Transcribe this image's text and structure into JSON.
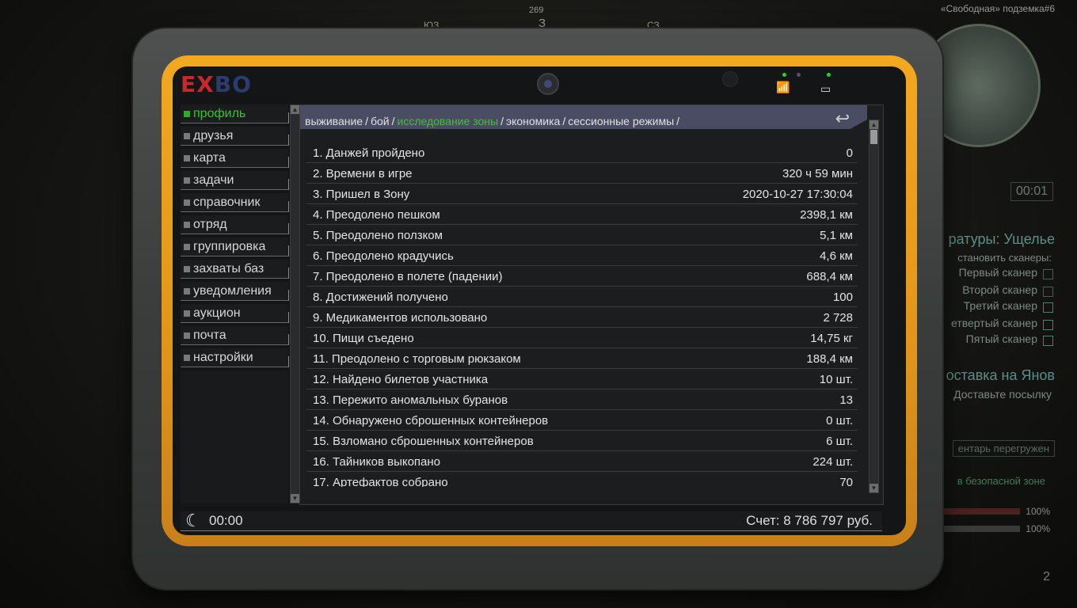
{
  "hud": {
    "compass": {
      "heading": "269",
      "w": "З",
      "sw": "ЮЗ",
      "nw": "СЗ"
    },
    "location": "«Свободная» подземка#6",
    "timer": "00:01",
    "quest": {
      "title": "ратуры: Ущелье",
      "subtitle": "становить сканеры:",
      "items": [
        "Первый сканер",
        "Второй сканер",
        "Третий сканер",
        "етвертый сканер",
        "Пятый сканер"
      ]
    },
    "quest2": {
      "title": "оставка на Янов",
      "subtitle": "Доставьте посылку"
    },
    "warning": "ентарь перегружен",
    "safe_zone": "в безопасной зоне",
    "health_pct": "100%",
    "stamina_pct": "100%",
    "counter": "2"
  },
  "pda": {
    "brand_e": "E",
    "brand_x": "X",
    "brand_bo": "BO",
    "sidebar": [
      {
        "label": "профиль",
        "active": true
      },
      {
        "label": "друзья"
      },
      {
        "label": "карта"
      },
      {
        "label": "задачи"
      },
      {
        "label": "справочник"
      },
      {
        "label": "отряд"
      },
      {
        "label": "группировка"
      },
      {
        "label": "захваты баз"
      },
      {
        "label": "уведомления"
      },
      {
        "label": "аукцион"
      },
      {
        "label": "почта"
      },
      {
        "label": "настройки"
      }
    ],
    "breadcrumbs": [
      {
        "label": "выживание"
      },
      {
        "label": "бой"
      },
      {
        "label": "исследование зоны",
        "active": true
      },
      {
        "label": "экономика"
      },
      {
        "label": "сессионные режимы"
      }
    ],
    "stats": [
      {
        "label": "1. Данжей пройдено",
        "value": "0"
      },
      {
        "label": "2. Времени в игре",
        "value": "320 ч 59 мин"
      },
      {
        "label": "3. Пришел в Зону",
        "value": "2020-10-27 17:30:04"
      },
      {
        "label": "4. Преодолено пешком",
        "value": "2398,1 км"
      },
      {
        "label": "5. Преодолено ползком",
        "value": "5,1 км"
      },
      {
        "label": "6. Преодолено крадучись",
        "value": "4,6 км"
      },
      {
        "label": "7. Преодолено в полете (падении)",
        "value": "688,4 км"
      },
      {
        "label": "8. Достижений получено",
        "value": "100"
      },
      {
        "label": "9. Медикаментов использовано",
        "value": "2 728"
      },
      {
        "label": "10. Пищи съедено",
        "value": "14,75 кг"
      },
      {
        "label": "11. Преодолено с торговым рюкзаком",
        "value": "188,4 км"
      },
      {
        "label": "12. Найдено билетов участника",
        "value": "10 шт."
      },
      {
        "label": "13. Пережито аномальных буранов",
        "value": "13"
      },
      {
        "label": "14. Обнаружено сброшенных контейнеров",
        "value": "0 шт."
      },
      {
        "label": "15. Взломано сброшенных контейнеров",
        "value": "6 шт."
      },
      {
        "label": "16. Тайников выкопано",
        "value": "224 шт."
      },
      {
        "label": "17. Артефактов собрано",
        "value": "70"
      }
    ],
    "footer": {
      "time": "00:00",
      "balance": "Счет: 8 786 797 руб."
    }
  }
}
